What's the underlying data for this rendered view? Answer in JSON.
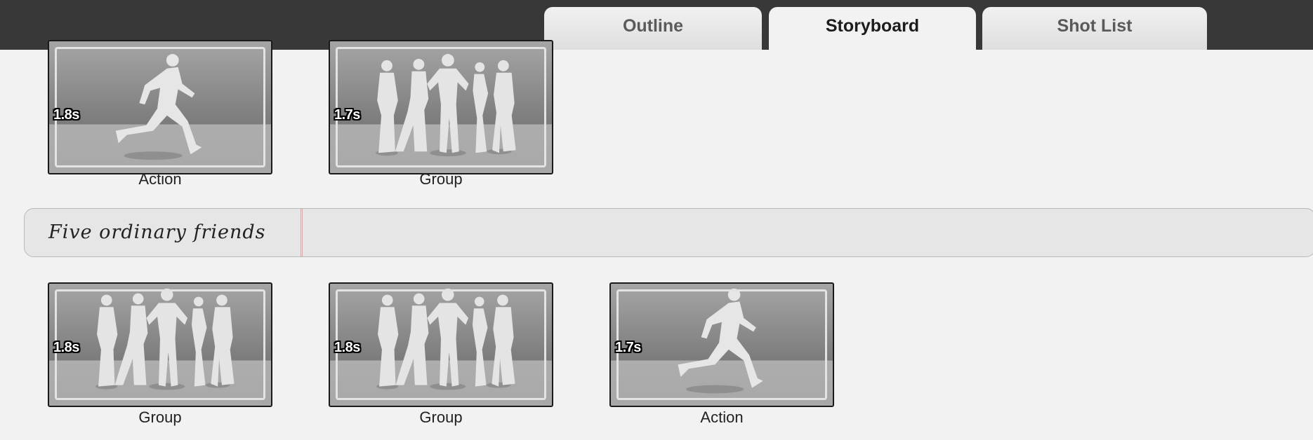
{
  "tabs": [
    {
      "label": "Outline",
      "active": false
    },
    {
      "label": "Storyboard",
      "active": true
    },
    {
      "label": "Shot List",
      "active": false
    }
  ],
  "scene_heading": "Five ordinary friends",
  "shots_row1": [
    {
      "duration": "1.8s",
      "label": "Action",
      "image": "runner-silhouette"
    },
    {
      "duration": "1.7s",
      "label": "Group",
      "image": "group-silhouette"
    }
  ],
  "shots_row2": [
    {
      "duration": "1.8s",
      "label": "Group",
      "image": "group-silhouette"
    },
    {
      "duration": "1.8s",
      "label": "Group",
      "image": "group-silhouette"
    },
    {
      "duration": "1.7s",
      "label": "Action",
      "image": "runner-silhouette"
    }
  ]
}
